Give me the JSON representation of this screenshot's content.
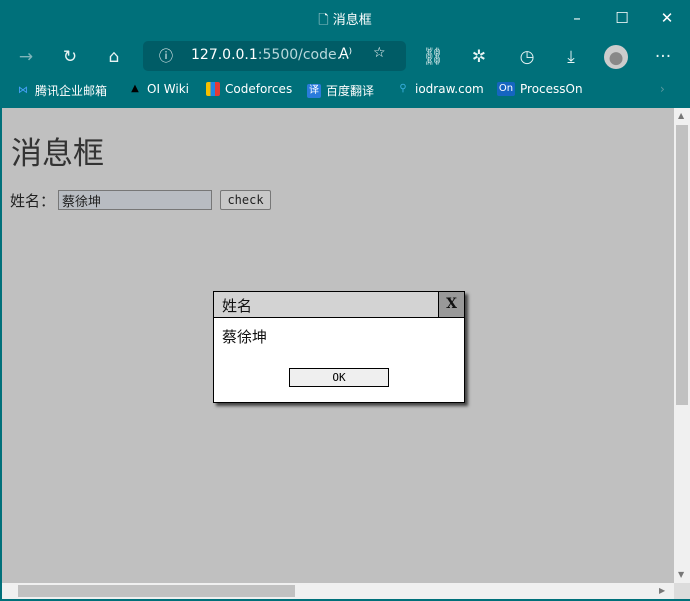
{
  "window": {
    "title": "消息框"
  },
  "toolbar": {
    "address": "127.0.0.1",
    "address_rest": ":5500/code..."
  },
  "bookmarks": [
    {
      "label": "腾讯企业邮箱",
      "icon": "tencent-mail-icon"
    },
    {
      "label": "OI Wiki",
      "icon": "graduation-cap-icon"
    },
    {
      "label": "Codeforces",
      "icon": "codeforces-icon"
    },
    {
      "label": "百度翻译",
      "icon": "baidu-translate-icon",
      "glyph": "译"
    },
    {
      "label": "iodraw.com",
      "icon": "iodraw-icon"
    },
    {
      "label": "ProcessOn",
      "icon": "processon-icon",
      "glyph": "On"
    }
  ],
  "page": {
    "heading": "消息框",
    "name_label": "姓名：",
    "name_value": "蔡徐坤",
    "check_label": "check"
  },
  "dialog": {
    "title": "姓名",
    "close_label": "X",
    "message": "蔡徐坤",
    "ok_label": "OK"
  },
  "colors": {
    "chrome": "#00707a",
    "page_bg": "#c0c0c0"
  }
}
